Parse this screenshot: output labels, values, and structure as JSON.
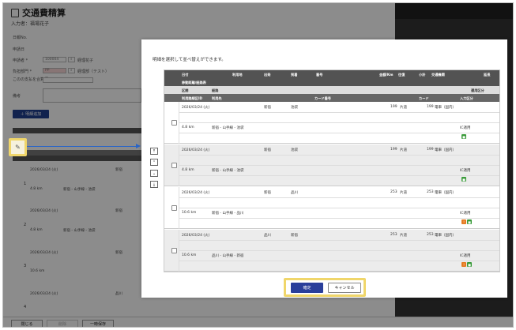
{
  "page": {
    "title": "交通費精算",
    "subtitle": "入力者：福場花子",
    "form_labels": [
      "日報No.",
      "申請日",
      "申請者 *",
      "負担部門 *",
      "このの支払を合算行",
      "備考"
    ],
    "applicant_code": "100004",
    "applicant_name": "経理花子",
    "dept_code": "PP",
    "dept_name": "経理部（テスト）",
    "add_button": "＋ 明細追加",
    "footer": {
      "close": "閉じる",
      "delete": "削除",
      "save": "一時保存"
    },
    "bg_row_date": "2026/03/24 (火)",
    "bg_row_dist": "4.8 km",
    "bg_row_route": "新宿 - 山手線 - 池袋",
    "bg_row_dist2": "10.6 km",
    "bg_row_from": "新宿",
    "bg_row_to": "品川",
    "bg_row_nums": [
      "1",
      "2",
      "3",
      "4"
    ]
  },
  "modal": {
    "description": "明細を選択して並べ替えができます。",
    "headers_row1": [
      "日付",
      "利用地",
      "出発",
      "到着",
      "番号",
      "金額/Km",
      "往復",
      "小計",
      "交通機関",
      "延長"
    ],
    "headers_row2": [
      "移動距離/経路表"
    ],
    "headers_row3": [
      "区間",
      "経路",
      "運用区分"
    ],
    "headers_row4": [
      "利用路線区ID",
      "利用先",
      "カード番号",
      "カード",
      "入力区分"
    ],
    "rows": [
      {
        "date": "2026/03/24 (火)",
        "from": "新宿",
        "to": "池袋",
        "amount": "199",
        "roundtrip": "片道",
        "subtotal": "199",
        "transport": "電車（国内）",
        "distance": "4.8 km",
        "route": "新宿 - 山手線 - 池袋",
        "badge": "IC適用",
        "icons": [
          "green"
        ]
      },
      {
        "date": "2026/03/24 (火)",
        "from": "新宿",
        "to": "池袋",
        "amount": "199",
        "roundtrip": "片道",
        "subtotal": "199",
        "transport": "電車（国内）",
        "distance": "4.8 km",
        "route": "新宿 - 山手線 - 池袋",
        "badge": "IC適用",
        "icons": [
          "green"
        ]
      },
      {
        "date": "2026/03/24 (火)",
        "from": "新宿",
        "to": "品川",
        "amount": "253",
        "roundtrip": "片道",
        "subtotal": "253",
        "transport": "電車（国内）",
        "distance": "10.6 km",
        "route": "新宿 - 山手線 - 品川",
        "badge": "IC適用",
        "icons": [
          "orange",
          "green"
        ]
      },
      {
        "date": "2026/03/24 (火)",
        "from": "品川",
        "to": "新宿",
        "amount": "253",
        "roundtrip": "片道",
        "subtotal": "253",
        "transport": "電車（国内）",
        "distance": "10.6 km",
        "route": "品川 - 山手線 - 新宿",
        "badge": "IC適用",
        "icons": [
          "orange",
          "green"
        ]
      }
    ],
    "move_buttons": [
      "top",
      "up",
      "down",
      "bottom"
    ],
    "ok_label": "確定",
    "cancel_label": "キャンセル"
  },
  "colors": {
    "primary": "#2a3f9a",
    "highlight": "#f0d66a",
    "arrow": "#2a65c7"
  }
}
